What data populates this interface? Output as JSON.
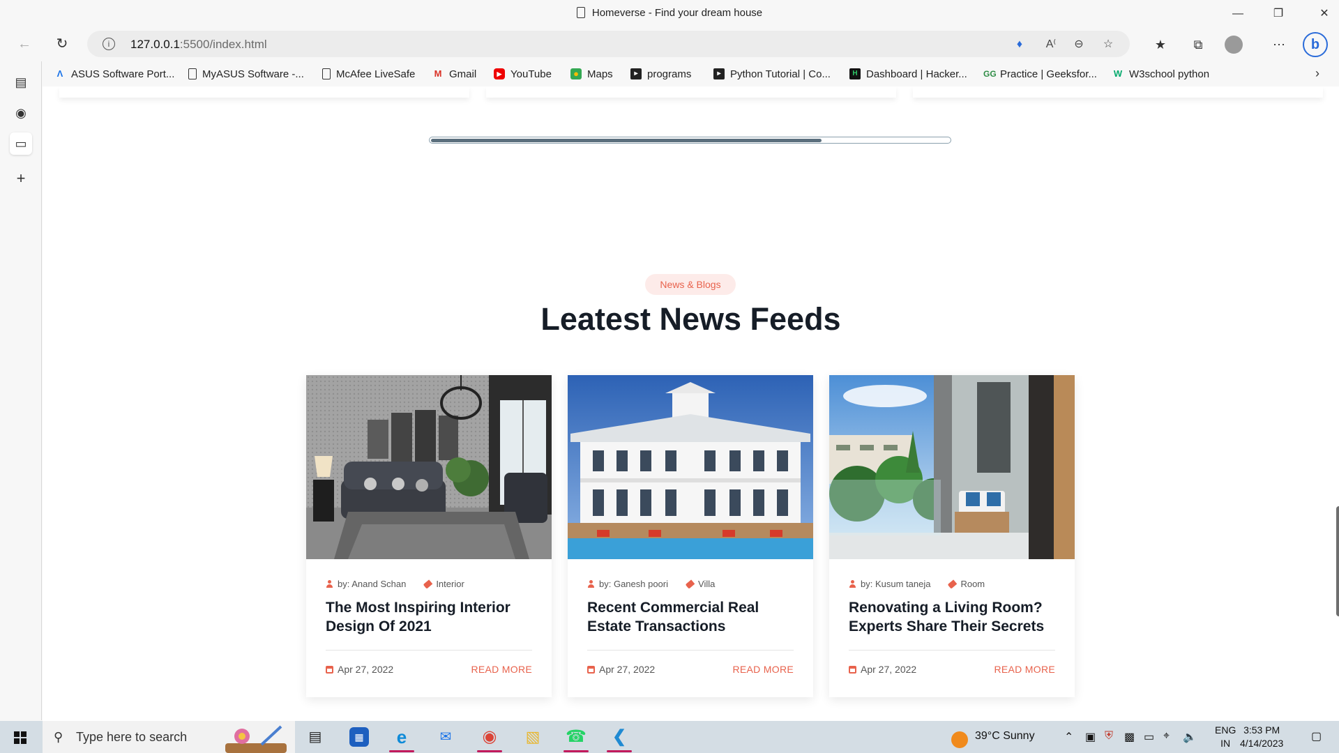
{
  "browser": {
    "tab_title": "Homeverse - Find your dream house",
    "url_host": "127.0.0.1",
    "url_path": ":5500/index.html",
    "bookmarks": [
      {
        "label": "ASUS Software Port...",
        "icon": "asus-icon"
      },
      {
        "label": "MyASUS Software -...",
        "icon": "page-icon"
      },
      {
        "label": "McAfee LiveSafe",
        "icon": "page-icon"
      },
      {
        "label": "Gmail",
        "icon": "gmail-icon"
      },
      {
        "label": "YouTube",
        "icon": "youtube-icon"
      },
      {
        "label": "Maps",
        "icon": "maps-icon"
      },
      {
        "label": "programs",
        "icon": "programs-icon"
      },
      {
        "label": "Python Tutorial | Co...",
        "icon": "codechef-icon"
      },
      {
        "label": "Dashboard | Hacker...",
        "icon": "hackerrank-icon"
      },
      {
        "label": "Practice | Geeksfor...",
        "icon": "geeksforgeeks-icon"
      },
      {
        "label": "W3school python",
        "icon": "w3schools-icon"
      }
    ]
  },
  "section": {
    "pill": "News & Blogs",
    "heading": "Leatest News Feeds"
  },
  "cards": [
    {
      "author": "by: Anand Schan",
      "tag": "Interior",
      "title": "The Most Inspiring Interior Design Of 2021",
      "date": "Apr 27, 2022",
      "read_more": "READ MORE"
    },
    {
      "author": "by: Ganesh poori",
      "tag": "Villa",
      "title": "Recent Commercial Real Estate Transactions",
      "date": "Apr 27, 2022",
      "read_more": "READ MORE"
    },
    {
      "author": "by: Kusum taneja",
      "tag": "Room",
      "title": "Renovating a Living Room? Experts Share Their Secrets",
      "date": "Apr 27, 2022",
      "read_more": "READ MORE"
    }
  ],
  "taskbar": {
    "search_placeholder": "Type here to search",
    "weather": "39°C  Sunny",
    "lang_top": "ENG",
    "lang_bottom": "IN",
    "time": "3:53 PM",
    "date": "4/14/2023"
  },
  "colors": {
    "accent": "#e8624c",
    "heading": "#161d27"
  }
}
